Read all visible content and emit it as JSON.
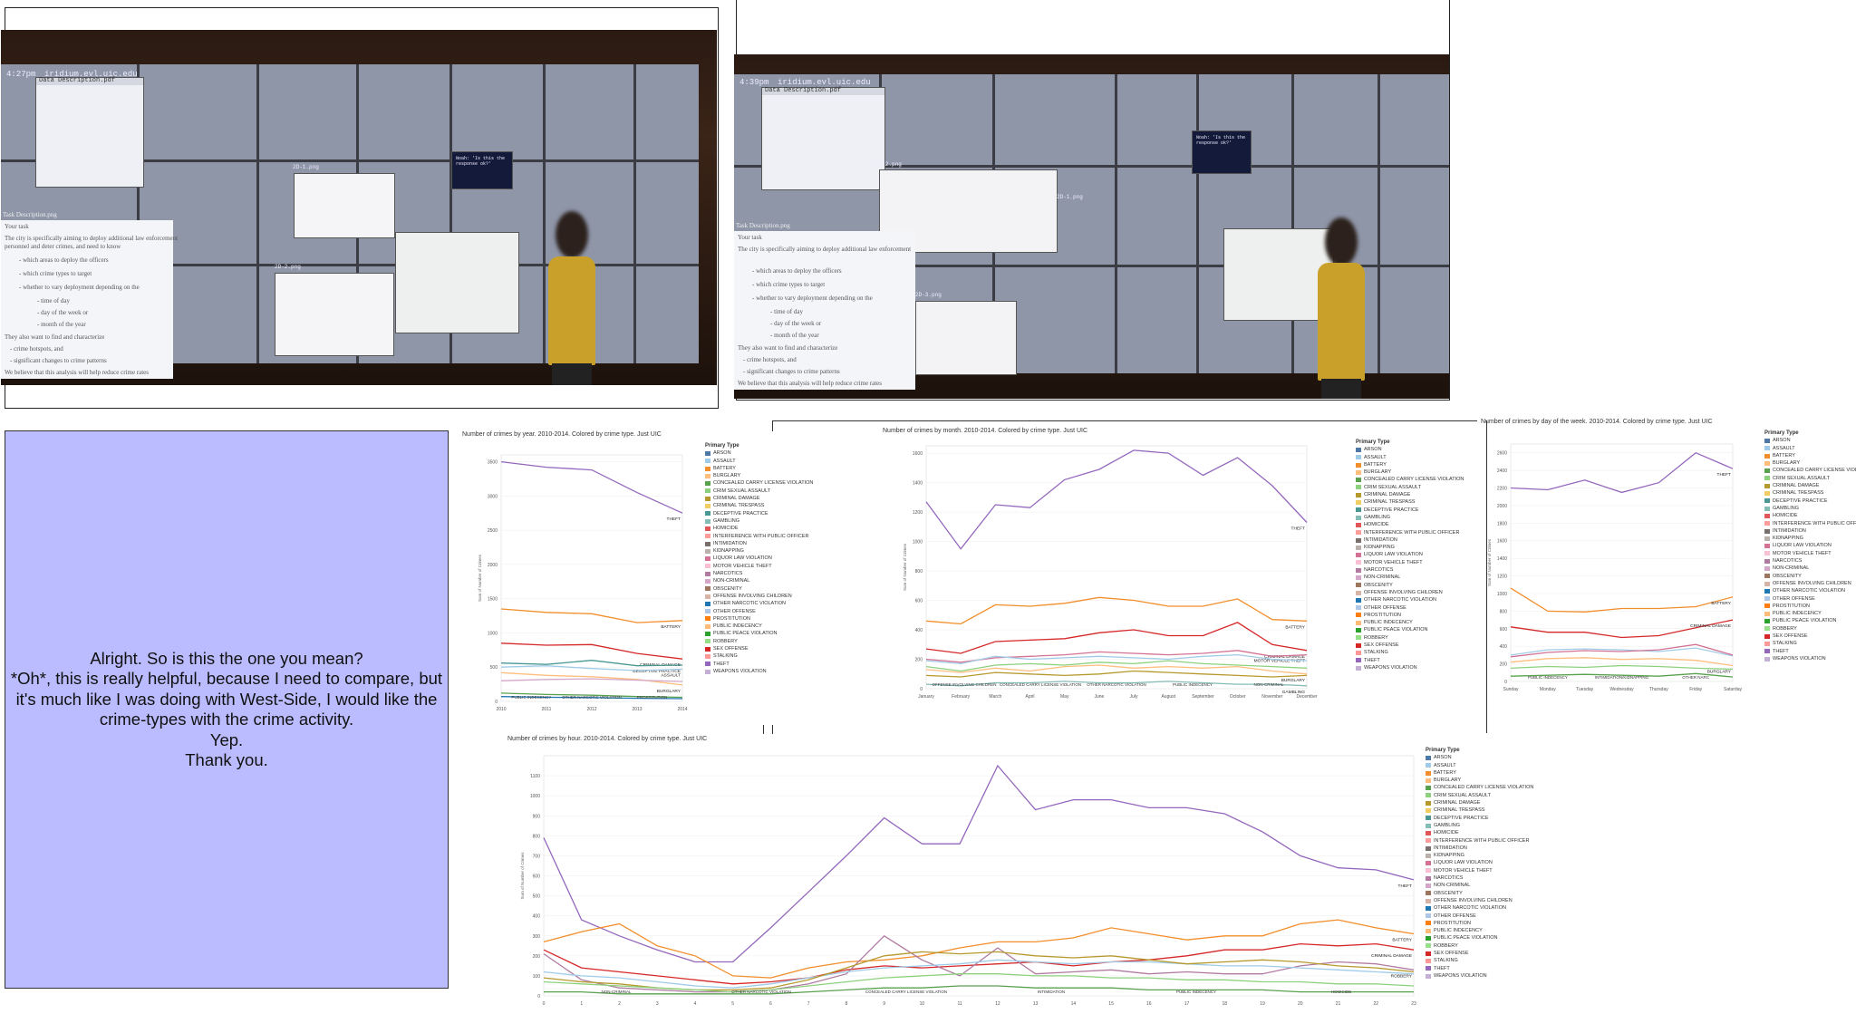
{
  "photo_left": {
    "time": "4:27pm",
    "host": "iridium.evl.uic.edu",
    "doc_title": "Data Description.pdf",
    "task_title": "Task Description.png",
    "task_lines": [
      "Your task",
      "The city is specifically aiming to deploy additional law enforcement",
      "personnel and deter crimes, and need to know",
      "- which areas to deploy the officers",
      "- which crime types to target",
      "- whether to vary deployment depending on the",
      "  - time of day",
      "  - day of the week or",
      "  - month of the year",
      "They also want to find and characterize",
      "- crime hotspots, and",
      "- significant changes to crime patterns",
      "We believe that this analysis will help reduce crime rates"
    ],
    "pane_labels": [
      "2D-1.png",
      "2D-2.png"
    ],
    "popup_text": "Noah: 'Is this the response ok?'"
  },
  "photo_right": {
    "time": "4:39pm",
    "host": "iridium.evl.uic.edu",
    "doc_title": "Data Description.pdf",
    "task_title": "Task Description.png",
    "pane_labels": [
      "3D-2.png",
      "2D-3.png",
      "2D-1.png"
    ],
    "popup_text": "Noah: 'Is this the response ok?'"
  },
  "dialogue": [
    "Alright. So is this the one you mean?",
    "*Oh*, this is really helpful, because I need to compare, but it's much like I was doing with West-Side, I would like the crime-types with the crime activity.",
    "Yep.",
    "Thank you."
  ],
  "legend": {
    "title": "Primary Type",
    "items": [
      {
        "label": "ARSON",
        "color": "#4e79a7"
      },
      {
        "label": "ASSAULT",
        "color": "#a0cbe8"
      },
      {
        "label": "BATTERY",
        "color": "#f28e2b"
      },
      {
        "label": "BURGLARY",
        "color": "#ffbe7d"
      },
      {
        "label": "CONCEALED CARRY LICENSE VIOLATION",
        "color": "#59a14f"
      },
      {
        "label": "CRIM SEXUAL ASSAULT",
        "color": "#8cd17d"
      },
      {
        "label": "CRIMINAL DAMAGE",
        "color": "#b6992d"
      },
      {
        "label": "CRIMINAL TRESPASS",
        "color": "#f1ce63"
      },
      {
        "label": "DECEPTIVE PRACTICE",
        "color": "#499894"
      },
      {
        "label": "GAMBLING",
        "color": "#86bcb6"
      },
      {
        "label": "HOMICIDE",
        "color": "#e15759"
      },
      {
        "label": "INTERFERENCE WITH PUBLIC OFFICER",
        "color": "#ff9d9a"
      },
      {
        "label": "INTIMIDATION",
        "color": "#79706e"
      },
      {
        "label": "KIDNAPPING",
        "color": "#bab0ac"
      },
      {
        "label": "LIQUOR LAW VIOLATION",
        "color": "#d37295"
      },
      {
        "label": "MOTOR VEHICLE THEFT",
        "color": "#fabfd2"
      },
      {
        "label": "NARCOTICS",
        "color": "#b07aa1"
      },
      {
        "label": "NON-CRIMINAL",
        "color": "#d4a6c8"
      },
      {
        "label": "OBSCENITY",
        "color": "#9d7660"
      },
      {
        "label": "OFFENSE INVOLVING CHILDREN",
        "color": "#d7b5a6"
      },
      {
        "label": "OTHER NARCOTIC VIOLATION",
        "color": "#1f77b4"
      },
      {
        "label": "OTHER OFFENSE",
        "color": "#aec7e8"
      },
      {
        "label": "PROSTITUTION",
        "color": "#ff7f0e"
      },
      {
        "label": "PUBLIC INDECENCY",
        "color": "#ffbb78"
      },
      {
        "label": "PUBLIC PEACE VIOLATION",
        "color": "#2ca02c"
      },
      {
        "label": "ROBBERY",
        "color": "#98df8a"
      },
      {
        "label": "SEX OFFENSE",
        "color": "#d62728"
      },
      {
        "label": "STALKING",
        "color": "#ff9896"
      },
      {
        "label": "THEFT",
        "color": "#9467bd"
      },
      {
        "label": "WEAPONS VIOLATION",
        "color": "#c5b0d5"
      }
    ]
  },
  "chart_data": [
    {
      "type": "line",
      "title": "Number of crimes by year.  2010-2014.  Colored by crime type.  Just UIC",
      "ylabel": "Sum of Number of Crimes",
      "x": [
        "2010",
        "2011",
        "2012",
        "2013",
        "2014"
      ],
      "yticks": [
        "0",
        "500",
        "1000",
        "1500",
        "2000",
        "2500",
        "3000",
        "3500"
      ],
      "ylim": [
        0,
        3600
      ],
      "series": [
        {
          "name": "THEFT",
          "color": "#9467bd",
          "values": [
            3500,
            3420,
            3380,
            3050,
            2750
          ]
        },
        {
          "name": "BATTERY",
          "color": "#f28e2b",
          "values": [
            1350,
            1300,
            1280,
            1150,
            1180
          ]
        },
        {
          "name": "CRIMINAL DAMAGE",
          "color": "#d62728",
          "values": [
            850,
            820,
            830,
            700,
            620
          ]
        },
        {
          "name": "DECEPTIVE PRACTICE",
          "color": "#499894",
          "values": [
            560,
            540,
            600,
            520,
            530
          ]
        },
        {
          "name": "ASSAULT",
          "color": "#a0cbe8",
          "values": [
            500,
            520,
            480,
            450,
            470
          ]
        },
        {
          "name": "BURGLARY",
          "color": "#ffbe7d",
          "values": [
            420,
            380,
            360,
            320,
            240
          ]
        },
        {
          "name": "",
          "color": "#d4a6c8",
          "values": [
            300,
            320,
            330,
            310,
            290
          ]
        },
        {
          "name": "",
          "color": "#59a14f",
          "values": [
            120,
            100,
            90,
            70,
            60
          ]
        },
        {
          "name": "",
          "color": "#1f77b4",
          "values": [
            70,
            60,
            55,
            45,
            40
          ]
        }
      ],
      "annotations": [
        "THEFT",
        "BATTERY",
        "CRIMINAL DAMAGE",
        "DECEPTIVE PRACTICE",
        "ASSAULT",
        "BURGLARY",
        "PUBLIC INDECENCY",
        "OTHER NARCOTIC VIOLATION",
        "PROSTITUTION"
      ]
    },
    {
      "type": "line",
      "title": "Number of crimes by month.  2010-2014.  Colored by crime type.  Just UIC",
      "ylabel": "Sum of Number of Crimes",
      "x": [
        "January",
        "February",
        "March",
        "April",
        "May",
        "June",
        "July",
        "August",
        "September",
        "October",
        "November",
        "December"
      ],
      "yticks": [
        "0",
        "200",
        "400",
        "600",
        "800",
        "1000",
        "1200",
        "1400",
        "1600"
      ],
      "ylim": [
        0,
        1650
      ],
      "series": [
        {
          "name": "THEFT",
          "color": "#9467bd",
          "values": [
            1270,
            950,
            1250,
            1230,
            1420,
            1490,
            1620,
            1600,
            1450,
            1570,
            1380,
            1130
          ]
        },
        {
          "name": "BATTERY",
          "color": "#f28e2b",
          "values": [
            460,
            440,
            570,
            560,
            580,
            620,
            600,
            560,
            560,
            610,
            470,
            460
          ]
        },
        {
          "name": "CRIMINAL DAMAGE",
          "color": "#d62728",
          "values": [
            270,
            240,
            320,
            330,
            340,
            380,
            400,
            360,
            360,
            450,
            300,
            260
          ]
        },
        {
          "name": "MOTOR VEHICLE THEFT",
          "color": "#d37295",
          "values": [
            200,
            180,
            210,
            220,
            230,
            250,
            240,
            230,
            240,
            260,
            220,
            230
          ]
        },
        {
          "name": "",
          "color": "#a0cbe8",
          "values": [
            190,
            170,
            220,
            200,
            210,
            220,
            210,
            200,
            220,
            230,
            200,
            190
          ]
        },
        {
          "name": "",
          "color": "#8cd17d",
          "values": [
            150,
            120,
            160,
            170,
            160,
            180,
            170,
            190,
            170,
            160,
            150,
            140
          ]
        },
        {
          "name": "BURGLARY",
          "color": "#ffbe7d",
          "values": [
            130,
            110,
            140,
            120,
            150,
            160,
            140,
            150,
            140,
            150,
            120,
            100
          ]
        },
        {
          "name": "",
          "color": "#b6992d",
          "values": [
            90,
            80,
            110,
            100,
            90,
            100,
            120,
            110,
            100,
            90,
            80,
            90
          ]
        },
        {
          "name": "GAMBLING",
          "color": "#86bcb6",
          "values": [
            30,
            20,
            40,
            40,
            50,
            40,
            40,
            50,
            40,
            30,
            30,
            20
          ]
        }
      ],
      "annotations": [
        "THEFT",
        "BATTERY",
        "CRIMINAL DAMAGE",
        "MOTOR VEHICLE THEFT",
        "BURGLARY",
        "OFFENSE INVOLVING CHILDREN",
        "GAMBLING",
        "CONCEALED CARRY LICENSE VIOLATION",
        "OTHER NARCOTIC VIOLATION",
        "PUBLIC INDECENCY",
        "NON-CRIMINAL"
      ]
    },
    {
      "type": "line",
      "title": "Number of crimes by day of the week.  2010-2014.  Colored by crime type.  Just UIC",
      "ylabel": "Sum of Number of Crimes",
      "x": [
        "Sunday",
        "Monday",
        "Tuesday",
        "Wednesday",
        "Thursday",
        "Friday",
        "Saturday"
      ],
      "yticks": [
        "0",
        "200",
        "400",
        "600",
        "800",
        "1000",
        "1200",
        "1400",
        "1600",
        "1800",
        "2000",
        "2200",
        "2400",
        "2600"
      ],
      "ylim": [
        0,
        2700
      ],
      "series": [
        {
          "name": "THEFT",
          "color": "#9467bd",
          "values": [
            2200,
            2180,
            2290,
            2150,
            2260,
            2600,
            2420
          ]
        },
        {
          "name": "BATTERY",
          "color": "#f28e2b",
          "values": [
            1060,
            800,
            790,
            830,
            830,
            850,
            960
          ]
        },
        {
          "name": "CRIMINAL DAMAGE",
          "color": "#d62728",
          "values": [
            620,
            560,
            560,
            500,
            520,
            610,
            700
          ]
        },
        {
          "name": "",
          "color": "#a0cbe8",
          "values": [
            300,
            360,
            370,
            360,
            340,
            380,
            290
          ]
        },
        {
          "name": "",
          "color": "#d37295",
          "values": [
            280,
            330,
            350,
            340,
            360,
            420,
            300
          ]
        },
        {
          "name": "BURGLARY",
          "color": "#ffbe7d",
          "values": [
            220,
            260,
            270,
            250,
            260,
            240,
            180
          ]
        },
        {
          "name": "",
          "color": "#8cd17d",
          "values": [
            150,
            170,
            160,
            180,
            170,
            150,
            140
          ]
        },
        {
          "name": "",
          "color": "#59a14f",
          "values": [
            60,
            70,
            80,
            70,
            60,
            90,
            50
          ]
        }
      ],
      "annotations": [
        "THEFT",
        "BATTERY",
        "CRIMINAL DAMAGE",
        "BURGLARY",
        "PUBLIC INDECENCY",
        "INTIMIDATION/KIDNAPPING",
        "OTHER NARC"
      ]
    },
    {
      "type": "line",
      "title": "Number of crimes by hour.  2010-2014.  Colored by crime type.  Just UIC",
      "ylabel": "Sum of Number of Crimes",
      "x": [
        "0",
        "1",
        "2",
        "3",
        "4",
        "5",
        "6",
        "7",
        "8",
        "9",
        "10",
        "11",
        "12",
        "13",
        "14",
        "15",
        "16",
        "17",
        "18",
        "19",
        "20",
        "21",
        "22",
        "23"
      ],
      "yticks": [
        "0",
        "100",
        "200",
        "300",
        "400",
        "500",
        "600",
        "700",
        "800",
        "900",
        "1000",
        "1100"
      ],
      "ylim": [
        0,
        1200
      ],
      "series": [
        {
          "name": "THEFT",
          "color": "#9467bd",
          "values": [
            790,
            380,
            300,
            230,
            170,
            170,
            340,
            520,
            700,
            890,
            760,
            760,
            1150,
            930,
            980,
            980,
            940,
            940,
            910,
            820,
            700,
            640,
            630,
            580
          ]
        },
        {
          "name": "BATTERY",
          "color": "#f28e2b",
          "values": [
            270,
            320,
            360,
            250,
            200,
            100,
            90,
            140,
            170,
            180,
            200,
            240,
            270,
            270,
            290,
            340,
            310,
            280,
            300,
            300,
            360,
            380,
            340,
            310
          ]
        },
        {
          "name": "CRIMINAL DAMAGE",
          "color": "#d62728",
          "values": [
            230,
            140,
            120,
            100,
            80,
            60,
            70,
            90,
            130,
            150,
            140,
            150,
            160,
            170,
            150,
            170,
            180,
            200,
            230,
            230,
            260,
            250,
            260,
            230
          ]
        },
        {
          "name": "ROBBERY",
          "color": "#b07aa1",
          "values": [
            210,
            80,
            40,
            30,
            20,
            20,
            30,
            60,
            110,
            300,
            180,
            100,
            240,
            110,
            120,
            130,
            110,
            120,
            110,
            110,
            150,
            170,
            160,
            130
          ]
        },
        {
          "name": "",
          "color": "#a0cbe8",
          "values": [
            120,
            100,
            90,
            70,
            50,
            40,
            60,
            90,
            120,
            140,
            150,
            160,
            180,
            170,
            160,
            170,
            170,
            160,
            150,
            150,
            140,
            130,
            120,
            110
          ]
        },
        {
          "name": "",
          "color": "#b6992d",
          "values": [
            90,
            70,
            60,
            40,
            30,
            30,
            40,
            80,
            140,
            200,
            220,
            210,
            220,
            200,
            190,
            200,
            180,
            160,
            170,
            180,
            170,
            150,
            140,
            120
          ]
        },
        {
          "name": "",
          "color": "#8cd17d",
          "values": [
            70,
            60,
            50,
            40,
            30,
            20,
            30,
            50,
            70,
            90,
            100,
            110,
            110,
            100,
            100,
            90,
            90,
            80,
            80,
            70,
            70,
            60,
            60,
            50
          ]
        },
        {
          "name": "",
          "color": "#59a14f",
          "values": [
            20,
            20,
            10,
            10,
            10,
            10,
            10,
            20,
            30,
            40,
            40,
            50,
            50,
            40,
            40,
            40,
            30,
            30,
            30,
            30,
            20,
            20,
            20,
            20
          ]
        }
      ],
      "annotations": [
        "THEFT",
        "BATTERY",
        "CRIMINAL DAMAGE",
        "ROBBERY",
        "NON-CRIMINAL",
        "OTHER NARCOTIC VIOLATION",
        "CONCEALED CARRY LICENSE VIOLATION",
        "INTIMIDATION",
        "PUBLIC INDECENCY",
        "HOMICIDE"
      ]
    }
  ]
}
